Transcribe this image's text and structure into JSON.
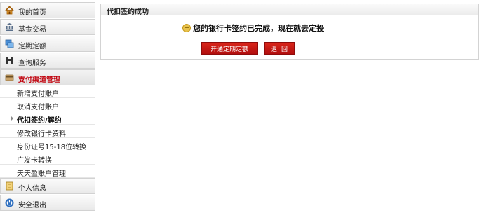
{
  "sidebar": {
    "menu_top": [
      {
        "label": "我的首页",
        "icon": "home-icon"
      },
      {
        "label": "基金交易",
        "icon": "bank-icon"
      },
      {
        "label": "定期定额",
        "icon": "stack-icon"
      },
      {
        "label": "查询服务",
        "icon": "binoculars-icon"
      },
      {
        "label": "支付渠道管理",
        "icon": "card-icon"
      }
    ],
    "sub_items": [
      {
        "label": "新增支付账户"
      },
      {
        "label": "取消支付账户"
      },
      {
        "label": "代扣签约/解约"
      },
      {
        "label": "修改银行卡资料"
      },
      {
        "label": "身份证号15-18位转换"
      },
      {
        "label": "广发卡转换"
      },
      {
        "label": "天天盈账户管理"
      }
    ],
    "menu_bottom": [
      {
        "label": "个人信息",
        "icon": "document-icon"
      },
      {
        "label": "安全退出",
        "icon": "power-icon"
      }
    ]
  },
  "panel": {
    "title": "代扣签约成功",
    "message": "您的银行卡签约已完成，现在就去定投",
    "open_button": "开通定期定额",
    "back_button": "返回"
  }
}
